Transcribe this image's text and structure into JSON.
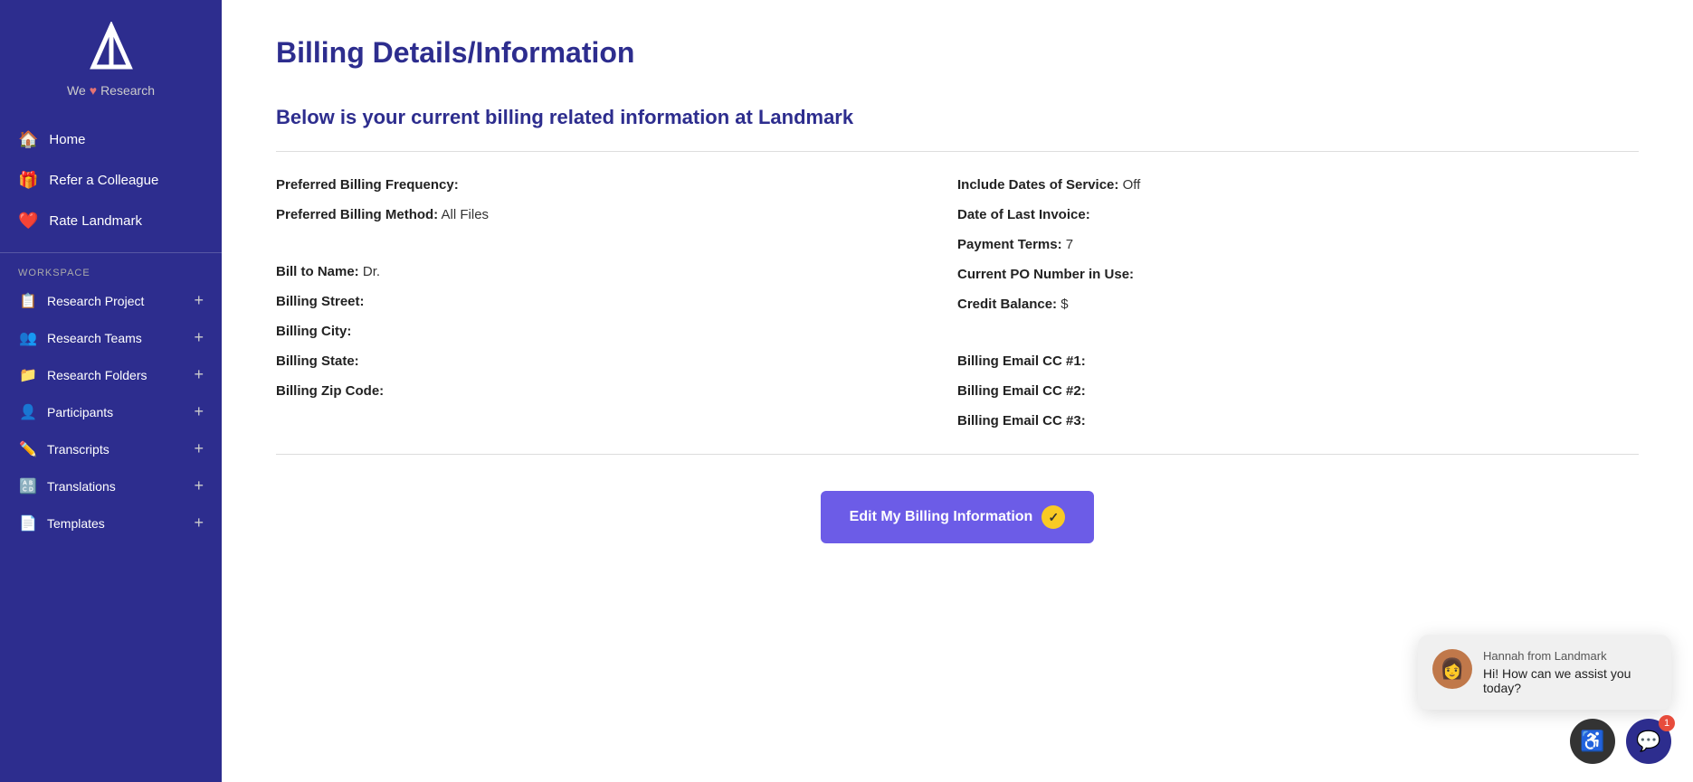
{
  "sidebar": {
    "logo_alt": "Landmark Logo",
    "tagline_pre": "We",
    "tagline_heart": "♥",
    "tagline_post": "Research",
    "nav": [
      {
        "id": "home",
        "label": "Home",
        "icon": "🏠"
      },
      {
        "id": "refer-colleague",
        "label": "Refer a Colleague",
        "icon": "🎁"
      },
      {
        "id": "rate-landmark",
        "label": "Rate Landmark",
        "icon": "❤️"
      }
    ],
    "workspace_label": "WORKSPACE",
    "workspace_items": [
      {
        "id": "research-project",
        "label": "Research Project",
        "icon": "📋",
        "plus": "+"
      },
      {
        "id": "research-teams",
        "label": "Research Teams",
        "icon": "👥",
        "plus": "+"
      },
      {
        "id": "research-folders",
        "label": "Research Folders",
        "icon": "📁",
        "plus": "+"
      },
      {
        "id": "participants",
        "label": "Participants",
        "icon": "👤",
        "plus": "+"
      },
      {
        "id": "transcripts",
        "label": "Transcripts",
        "icon": "✏️",
        "plus": "+"
      },
      {
        "id": "translations",
        "label": "Translations",
        "icon": "🔠",
        "plus": "+"
      },
      {
        "id": "templates",
        "label": "Templates",
        "icon": "📄",
        "plus": "+"
      }
    ]
  },
  "main": {
    "page_title": "Billing Details/Information",
    "subtitle": "Below is your current billing related information at Landmark",
    "billing_left": [
      {
        "label": "Preferred Billing Frequency:",
        "value": ""
      },
      {
        "label": "Preferred Billing Method:",
        "value": "All Files"
      },
      {
        "label": "",
        "value": ""
      },
      {
        "label": "Bill to Name:",
        "value": "Dr."
      },
      {
        "label": "Billing Street:",
        "value": ""
      },
      {
        "label": "Billing City:",
        "value": ""
      },
      {
        "label": "Billing State:",
        "value": ""
      },
      {
        "label": "Billing Zip Code:",
        "value": ""
      }
    ],
    "billing_right": [
      {
        "label": "Include Dates of Service:",
        "value": "Off"
      },
      {
        "label": "Date of Last Invoice:",
        "value": ""
      },
      {
        "label": "Payment Terms:",
        "value": "7"
      },
      {
        "label": "Current PO Number in Use:",
        "value": ""
      },
      {
        "label": "Credit Balance:",
        "value": "$"
      },
      {
        "label": "",
        "value": ""
      },
      {
        "label": "Billing Email CC #1:",
        "value": ""
      },
      {
        "label": "Billing Email CC #2:",
        "value": ""
      },
      {
        "label": "Billing Email CC #3:",
        "value": ""
      }
    ],
    "edit_button_label": "Edit My Billing Information",
    "edit_button_check": "✓"
  },
  "chat": {
    "agent_name": "Hannah from Landmark",
    "message": "Hi! How can we assist you today?",
    "avatar_emoji": "👩"
  },
  "bottom_bar": {
    "accessibility_icon": "♿",
    "chat_icon": "💬",
    "chat_badge": "1"
  }
}
